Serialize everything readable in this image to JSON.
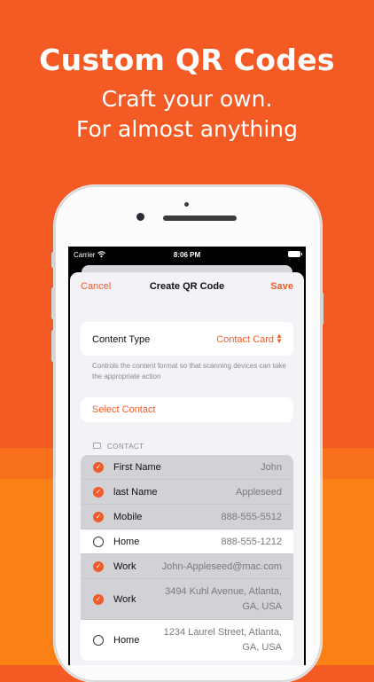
{
  "promo": {
    "headline": "Custom QR Codes",
    "subline1": "Craft your own.",
    "subline2": "For almost anything"
  },
  "status_bar": {
    "carrier": "Carrier",
    "time": "8:06 PM"
  },
  "nav": {
    "cancel": "Cancel",
    "title": "Create QR Code",
    "save": "Save"
  },
  "content_type": {
    "label": "Content Type",
    "value": "Contact Card",
    "help": "Controls the content format so that scanning devices can take the appropriate action"
  },
  "select_contact": "Select Contact",
  "contact_section": {
    "header": "CONTACT",
    "rows": [
      {
        "label": "First Name",
        "value": "John",
        "selected": true
      },
      {
        "label": "last Name",
        "value": "Appleseed",
        "selected": true
      },
      {
        "label": "Mobile",
        "value": "888-555-5512",
        "selected": true
      },
      {
        "label": "Home",
        "value": "888-555-1212",
        "selected": false
      },
      {
        "label": "Work",
        "value": "John-Appleseed@mac.com",
        "selected": true
      },
      {
        "label": "Work",
        "value": "3494 Kuhl Avenue, Atlanta,",
        "value2": "GA, USA",
        "selected": true
      },
      {
        "label": "Home",
        "value": "1234 Laurel Street, Atlanta,",
        "value2": "GA, USA",
        "selected": false
      }
    ]
  },
  "colors": {
    "background": "#f45a24",
    "accent": "#f25c2a"
  }
}
